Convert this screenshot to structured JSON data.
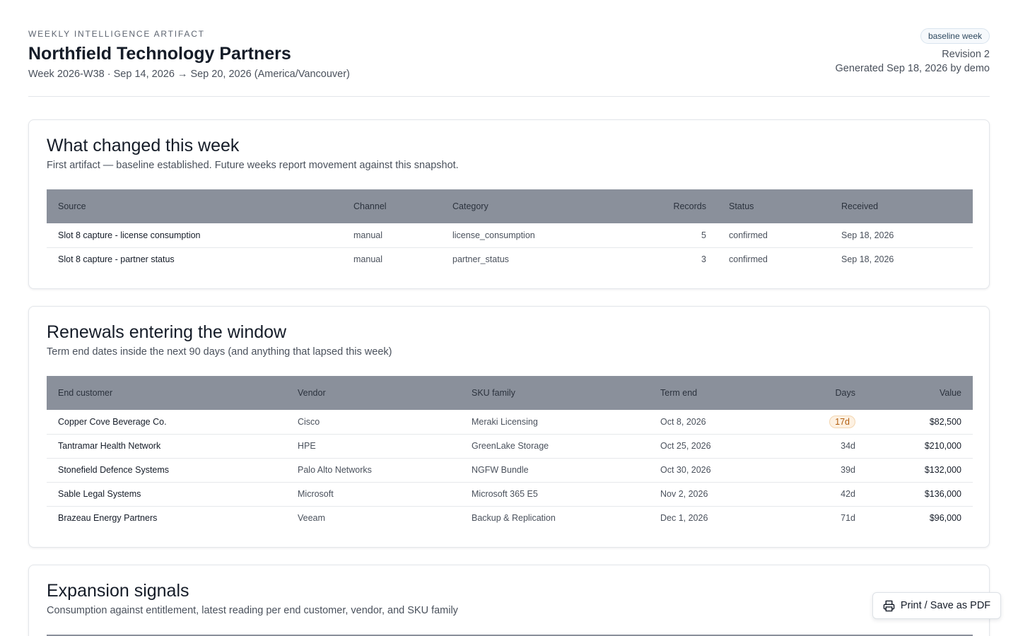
{
  "header": {
    "eyebrow": "WEEKLY INTELLIGENCE ARTIFACT",
    "title": "Northfield Technology Partners",
    "subtitle": "Week 2026-W38 · Sep 14, 2026 → Sep 20, 2026 (America/Vancouver)",
    "badge": "baseline week",
    "revision": "Revision 2",
    "generated": "Generated Sep 18, 2026 by demo"
  },
  "changes": {
    "title": "What changed this week",
    "subtitle": "First artifact — baseline established. Future weeks report movement against this snapshot.",
    "columns": [
      "Source",
      "Channel",
      "Category",
      "Records",
      "Status",
      "Received"
    ],
    "rows": [
      [
        "Slot 8 capture - license consumption",
        "manual",
        "license_consumption",
        "5",
        "confirmed",
        "Sep 18, 2026"
      ],
      [
        "Slot 8 capture - partner status",
        "manual",
        "partner_status",
        "3",
        "confirmed",
        "Sep 18, 2026"
      ]
    ]
  },
  "renewals": {
    "title": "Renewals entering the window",
    "subtitle": "Term end dates inside the next 90 days (and anything that lapsed this week)",
    "columns": [
      "End customer",
      "Vendor",
      "SKU family",
      "Term end",
      "Days",
      "Value"
    ],
    "rows": [
      [
        "Copper Cove Beverage Co.",
        "Cisco",
        "Meraki Licensing",
        "Oct 8, 2026",
        "17d",
        "$82,500"
      ],
      [
        "Tantramar Health Network",
        "HPE",
        "GreenLake Storage",
        "Oct 25, 2026",
        "34d",
        "$210,000"
      ],
      [
        "Stonefield Defence Systems",
        "Palo Alto Networks",
        "NGFW Bundle",
        "Oct 30, 2026",
        "39d",
        "$132,000"
      ],
      [
        "Sable Legal Systems",
        "Microsoft",
        "Microsoft 365 E5",
        "Nov 2, 2026",
        "42d",
        "$136,000"
      ],
      [
        "Brazeau Energy Partners",
        "Veeam",
        "Backup & Replication",
        "Dec 1, 2026",
        "71d",
        "$96,000"
      ]
    ]
  },
  "expansion": {
    "title": "Expansion signals",
    "subtitle": "Consumption against entitlement, latest reading per end customer, vendor, and SKU family"
  },
  "print_button": {
    "label": "Print / Save as PDF",
    "icon": "printer-icon"
  }
}
